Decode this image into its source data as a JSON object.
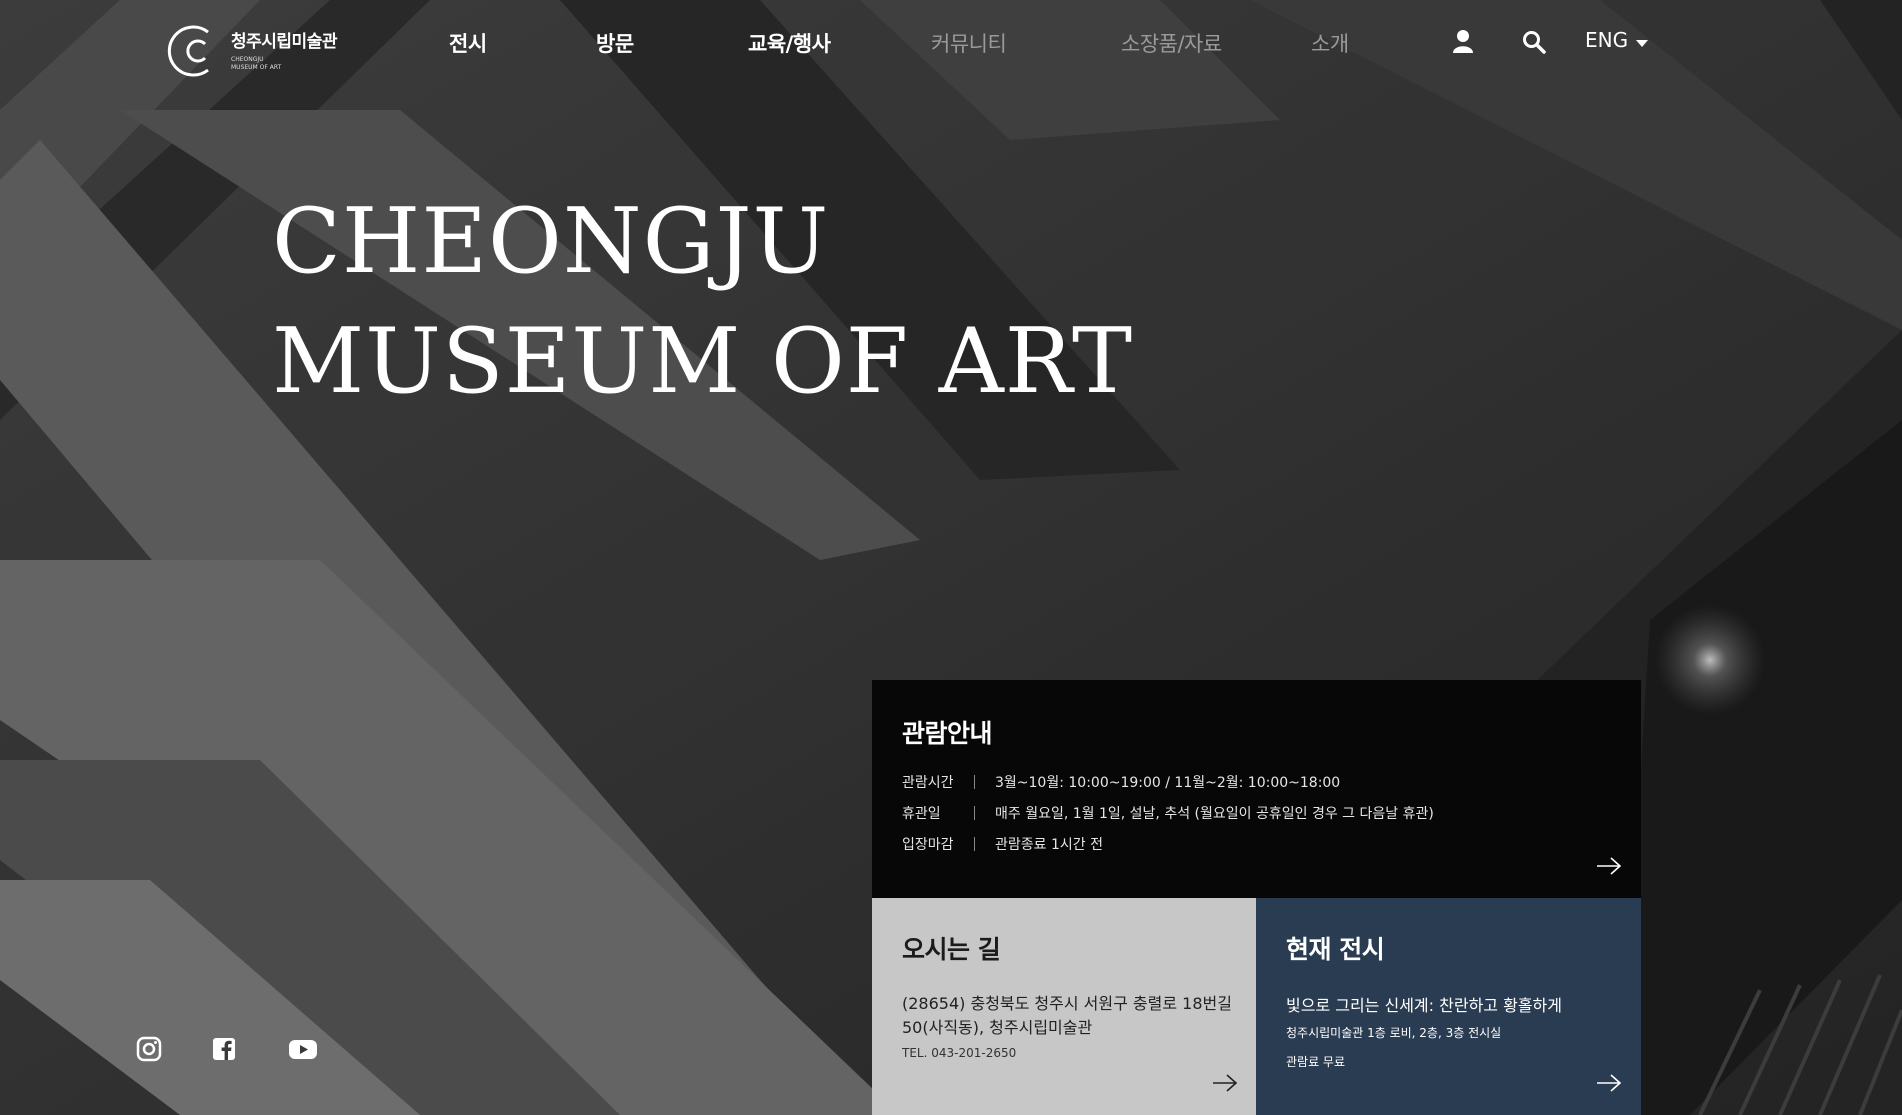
{
  "logo": {
    "korean": "청주시립미술관",
    "english": "CHEONGJU\nMUSEUM OF ART"
  },
  "nav": {
    "items": [
      {
        "label": "전시"
      },
      {
        "label": "방문"
      },
      {
        "label": "교육/행사"
      },
      {
        "label": "커뮤니티"
      },
      {
        "label": "소장품/자료"
      },
      {
        "label": "소개"
      }
    ],
    "icons": [
      "user-icon",
      "search-icon"
    ],
    "language": "ENG"
  },
  "hero": {
    "title_line1": "CHEONGJU",
    "title_line2": "MUSEUM OF ART"
  },
  "guide": {
    "title": "관람안내",
    "rows": [
      {
        "label": "관람시간",
        "value": "3월~10월: 10:00~19:00 / 11월~2월: 10:00~18:00"
      },
      {
        "label": "휴관일",
        "value": "매주 월요일, 1월 1일, 설날, 추석 (월요일이 공휴일인 경우 그 다음날 휴관)"
      },
      {
        "label": "입장마감",
        "value": "관람종료 1시간 전"
      }
    ]
  },
  "directions": {
    "title": "오시는 길",
    "address": "(28654) 충청북도 청주시 서원구 충렬로 18번길 50(사직동), 청주시립미술관",
    "tel": "TEL. 043-201-2650"
  },
  "current": {
    "title": "현재 전시",
    "exhibition": "빛으로 그리는 신세계: 찬란하고 황홀하게",
    "location": "청주시립미술관 1층 로비, 2층, 3층 전시실",
    "fee": "관람료 무료"
  },
  "social": [
    "instagram-icon",
    "facebook-icon",
    "youtube-icon"
  ],
  "colors": {
    "guide_bg": "#070707",
    "directions_bg": "#c7c7c7",
    "current_bg": "#2a3c52"
  }
}
